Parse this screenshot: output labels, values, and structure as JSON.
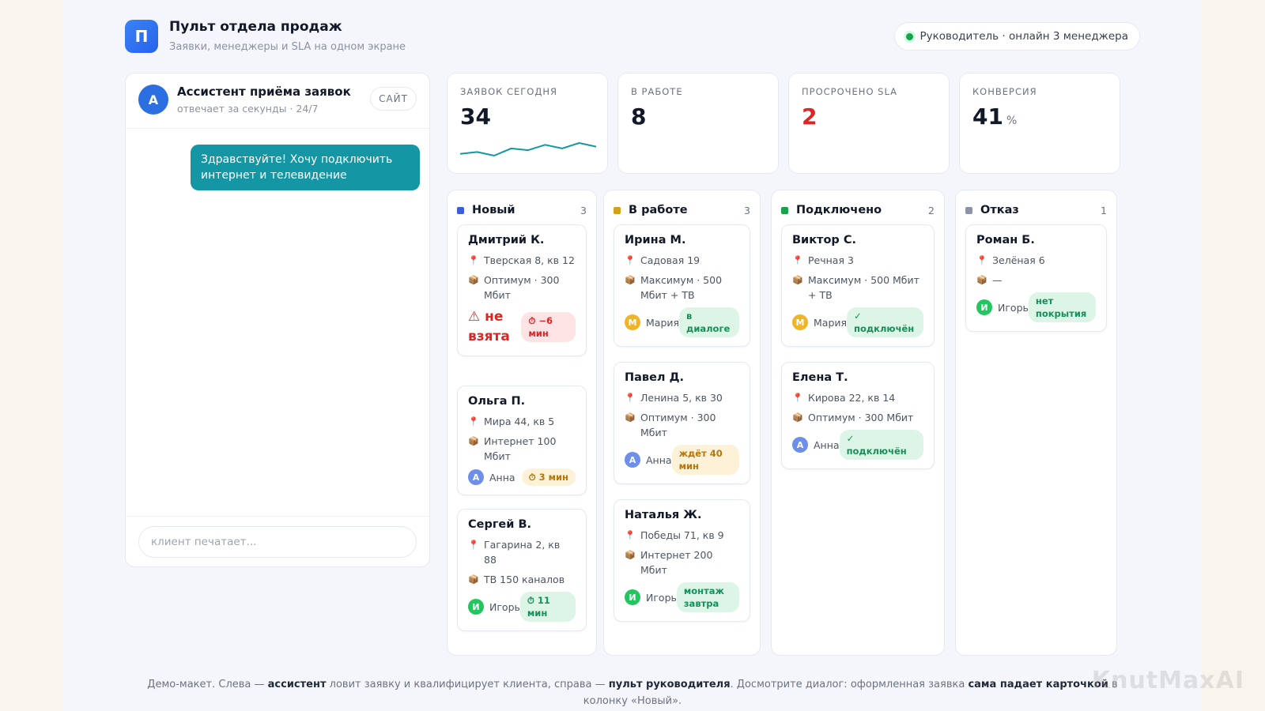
{
  "header": {
    "logo_letter": "П",
    "title": "Пульт отдела продаж",
    "subtitle": "Заявки, менеджеры и SLA на одном экране",
    "status": "Руководитель · онлайн 3 менеджера"
  },
  "chat": {
    "avatar_letter": "А",
    "title": "Ассистент приёма заявок",
    "subtitle": "отвечает за секунды · 24/7",
    "channel": "САЙТ",
    "message": "Здравствуйте! Хочу подключить интернет и телевидение",
    "input_placeholder": "клиент печатает..."
  },
  "kpis": [
    {
      "label": "Заявок сегодня",
      "value": "34",
      "unit": "",
      "trend": [
        2,
        2.5,
        1.5,
        3.5,
        3,
        4.5,
        3.5,
        5,
        4
      ]
    },
    {
      "label": "В работе",
      "value": "8",
      "unit": ""
    },
    {
      "label": "Просрочено SLA",
      "value": "2",
      "unit": ""
    },
    {
      "label": "Конверсия",
      "value": "41",
      "unit": "%"
    }
  ],
  "columns": [
    {
      "name": "Новый",
      "count": "3",
      "color": "#3b5bdb",
      "cards": [
        {
          "name": "Дмитрий К.",
          "address": "Тверская 8, кв 12",
          "plan": "Оптимум · 300 Мбит",
          "warning": "⚠ не взята",
          "badge": "⏱ −6 мин",
          "badge_type": "red"
        },
        {
          "name": "Ольга П.",
          "address": "Мира 44, кв 5",
          "plan": "Интернет 100 Мбит",
          "manager": "Анна",
          "manager_initial": "А",
          "manager_color": "#6d8ee9",
          "badge": "⏱ 3 мин",
          "badge_type": "amber"
        },
        {
          "name": "Сергей В.",
          "address": "Гагарина 2, кв 88",
          "plan": "ТВ 150 каналов",
          "manager": "Игорь",
          "manager_initial": "И",
          "manager_color": "#22c55e",
          "badge": "⏱ 11 мин",
          "badge_type": "green"
        }
      ]
    },
    {
      "name": "В работе",
      "count": "3",
      "color": "#d4a017",
      "cards": [
        {
          "name": "Ирина М.",
          "address": "Садовая 19",
          "plan": "Максимум · 500 Мбит + ТВ",
          "manager": "Мария",
          "manager_initial": "М",
          "manager_color": "#f0b429",
          "badge": "в диалоге",
          "badge_type": "green"
        },
        {
          "name": "Павел Д.",
          "address": "Ленина 5, кв 30",
          "plan": "Оптимум · 300 Мбит",
          "manager": "Анна",
          "manager_initial": "А",
          "manager_color": "#6d8ee9",
          "badge": "ждёт 40 мин",
          "badge_type": "amber"
        },
        {
          "name": "Наталья Ж.",
          "address": "Победы 71, кв 9",
          "plan": "Интернет 200 Мбит",
          "manager": "Игорь",
          "manager_initial": "И",
          "manager_color": "#22c55e",
          "badge": "монтаж завтра",
          "badge_type": "green"
        }
      ]
    },
    {
      "name": "Подключено",
      "count": "2",
      "color": "#16a34a",
      "cards": [
        {
          "name": "Виктор С.",
          "address": "Речная 3",
          "plan": "Максимум · 500 Мбит + ТВ",
          "manager": "Мария",
          "manager_initial": "М",
          "manager_color": "#f0b429",
          "badge": "✓ подключён",
          "badge_type": "green"
        },
        {
          "name": "Елена Т.",
          "address": "Кирова 22, кв 14",
          "plan": "Оптимум · 300 Мбит",
          "manager": "Анна",
          "manager_initial": "А",
          "manager_color": "#6d8ee9",
          "badge": "✓ подключён",
          "badge_type": "green"
        }
      ]
    },
    {
      "name": "Отказ",
      "count": "1",
      "color": "#8b93a7",
      "cards": [
        {
          "name": "Роман Б.",
          "address": "Зелёная 6",
          "plan": "—",
          "manager": "Игорь",
          "manager_initial": "И",
          "manager_color": "#22c55e",
          "badge": "нет покрытия",
          "badge_type": "green"
        }
      ]
    }
  ],
  "footer": {
    "p1": "Демо-макет. Слева — ",
    "b1": "ассистент",
    "p2": " ловит заявку и квалифицирует клиента, справа — ",
    "b2": "пульт руководителя",
    "p3": ". Досмотрите диалог: оформленная заявка ",
    "b3": "сама падает карточкой",
    "p4": " в колонку «Новый»."
  },
  "watermark": "KnutMaxAI",
  "icons": {
    "address": "📍",
    "plan": "📦"
  }
}
